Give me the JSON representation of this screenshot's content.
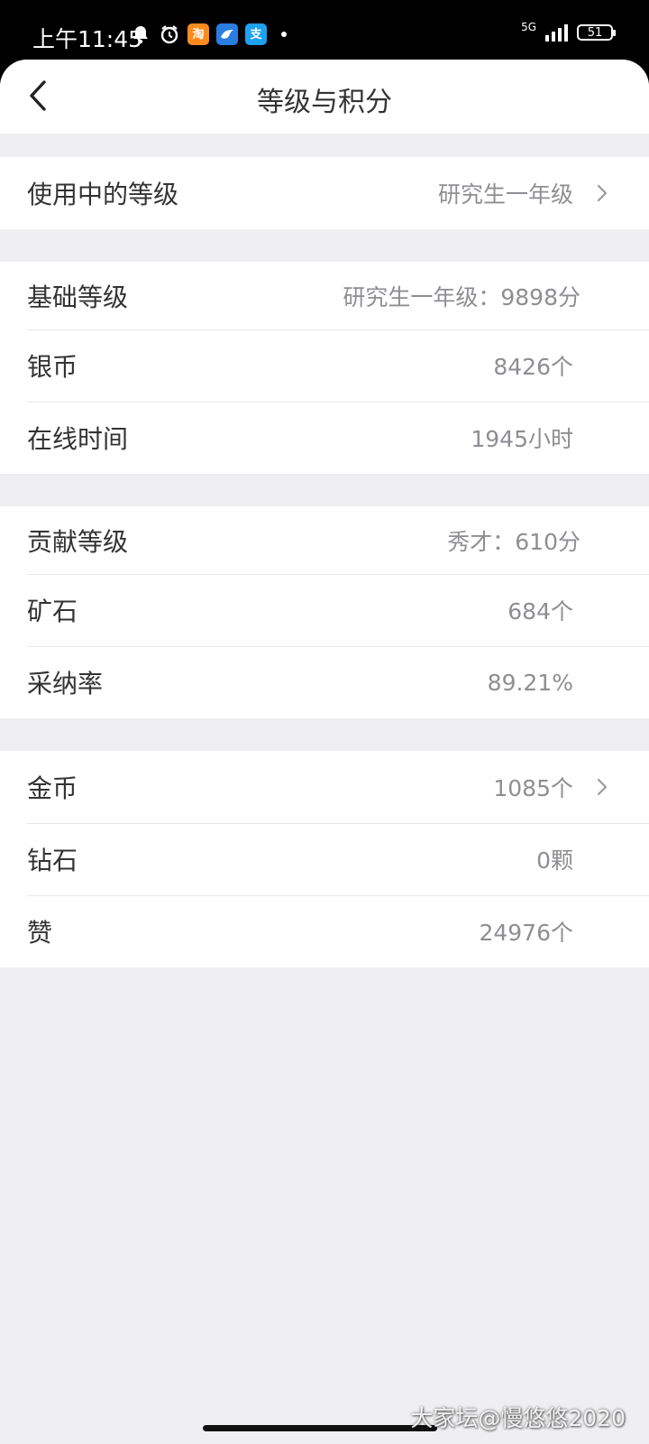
{
  "status_bar": {
    "time": "上午11:45",
    "network": "5G",
    "battery": "51",
    "icons": [
      "bell-icon",
      "alarm-icon",
      "taobao-icon",
      "app-icon",
      "alipay-icon"
    ],
    "taobao_glyph": "淘",
    "alipay_glyph": "支"
  },
  "nav": {
    "title": "等级与积分",
    "back_icon": "chevron-left-icon"
  },
  "groups": [
    {
      "rows": [
        {
          "label": "使用中的等级",
          "value": "研究生一年级",
          "chevron": true
        }
      ]
    },
    {
      "rows": [
        {
          "label": "基础等级",
          "value": "研究生一年级：9898分",
          "chevron": false
        },
        {
          "label": "银币",
          "value": "8426个",
          "chevron": false
        },
        {
          "label": "在线时间",
          "value": "1945小时",
          "chevron": false
        }
      ]
    },
    {
      "rows": [
        {
          "label": "贡献等级",
          "value": "秀才：610分",
          "chevron": false
        },
        {
          "label": "矿石",
          "value": "684个",
          "chevron": false
        },
        {
          "label": "采纳率",
          "value": "89.21%",
          "chevron": false
        }
      ]
    },
    {
      "rows": [
        {
          "label": "金币",
          "value": "1085个",
          "chevron": true
        },
        {
          "label": "钻石",
          "value": "0颗",
          "chevron": false
        },
        {
          "label": "赞",
          "value": "24976个",
          "chevron": false
        }
      ]
    }
  ],
  "watermark": "大家坛@慢悠悠2020",
  "colors": {
    "background": "#efeff1",
    "label": "#333333",
    "value": "#8e8e93",
    "divider": "#e8e8ea"
  }
}
